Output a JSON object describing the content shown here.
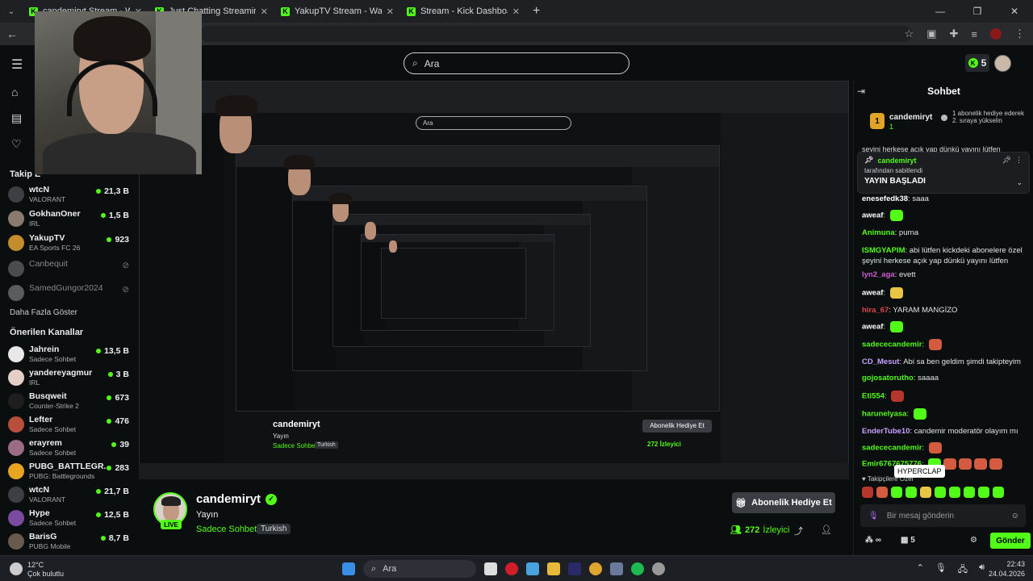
{
  "browser": {
    "tabs": [
      {
        "title": "candemiryt Stream - Watch Live on Kick"
      },
      {
        "title": "Just Chatting Streaming - Live on Kick"
      },
      {
        "title": "YakupTV Stream - Watch Live on Kick"
      },
      {
        "title": "Stream - Kick Dashboard"
      }
    ]
  },
  "topbar": {
    "search_placeholder": "Ara",
    "points": "5"
  },
  "sidebar": {
    "nav": [
      {
        "label": "A"
      },
      {
        "label": "G"
      },
      {
        "label": "T"
      }
    ],
    "following_title": "Takip E",
    "following": [
      {
        "name": "wtcN",
        "sub": "VALORANT",
        "viewers": "21,3 B",
        "online": true
      },
      {
        "name": "GokhanOner",
        "sub": "IRL",
        "viewers": "1,5 B",
        "online": true
      },
      {
        "name": "YakupTV",
        "sub": "EA Sports FC 26",
        "viewers": "923",
        "online": true
      },
      {
        "name": "Canbequit",
        "sub": "",
        "viewers": "",
        "online": false
      },
      {
        "name": "SamedGungor2024",
        "sub": "",
        "viewers": "",
        "online": false
      }
    ],
    "show_more": "Daha Fazla Göster",
    "recommended_title": "Önerilen Kanallar",
    "recommended": [
      {
        "name": "Jahrein",
        "sub": "Sadece Sohbet",
        "viewers": "13,5 B"
      },
      {
        "name": "yandereyagmur",
        "sub": "IRL",
        "viewers": "3 B"
      },
      {
        "name": "Busqweit",
        "sub": "Counter-Strike 2",
        "viewers": "673"
      },
      {
        "name": "Lefter",
        "sub": "Sadece Sohbet",
        "viewers": "476"
      },
      {
        "name": "erayrem",
        "sub": "Sadece Sohbet",
        "viewers": "39"
      },
      {
        "name": "PUBG_BATTLEGR...",
        "sub": "PUBG: Battlegrounds",
        "viewers": "283"
      },
      {
        "name": "wtcN",
        "sub": "VALORANT",
        "viewers": "21,7 B"
      },
      {
        "name": "Hype",
        "sub": "Sadece Sohbet",
        "viewers": "12,5 B"
      },
      {
        "name": "BarisG",
        "sub": "PUBG Mobile",
        "viewers": "8,7 B"
      }
    ]
  },
  "stream_inner": {
    "name": "candemiryt",
    "title": "Yayın",
    "category": "Sadece Sohbet",
    "language": "Turkish",
    "gift": "Abonelik Hediye Et",
    "viewers": "272",
    "viewers_label": "İzleyici"
  },
  "profile": {
    "name": "candemiryt",
    "live": "LIVE",
    "title": "Yayın",
    "category": "Sadece Sohbet",
    "language": "Turkish",
    "gift_button": "Abonelik Hediye Et",
    "viewers": "272",
    "viewers_label": "İzleyici"
  },
  "chat": {
    "title": "Sohbet",
    "gifter": {
      "name": "candemiryt",
      "badge": "1",
      "count": "1",
      "text": "1 abonelik hediye ederek 2. sıraya yükselin"
    },
    "overflow_text": "şeyini herkese açık yap dünkü yayını lütfen",
    "pinned": {
      "by": "candemiryt",
      "label": "tarafından sabitlendi",
      "message": "YAYIN BAŞLADI"
    },
    "messages": [
      {
        "user": "enesefedk38",
        "color": "#ffffff",
        "text": "saaa",
        "emotes": []
      },
      {
        "user": "aweaf",
        "color": "#ffffff",
        "text": "",
        "emotes": [
          "g"
        ]
      },
      {
        "user": "Animuna",
        "color": "#53fc18",
        "text": "purna",
        "emotes": []
      },
      {
        "user": "ISMGYAPIM",
        "color": "#53fc18",
        "text": "abi lütfen kickdeki abonelere özel şeyini herkese açık yap dünkü yayını lütfen",
        "emotes": []
      },
      {
        "user": "lyn2_aga",
        "color": "#d05dd6",
        "text": "evett",
        "emotes": []
      },
      {
        "user": "aweaf",
        "color": "#ffffff",
        "text": "",
        "emotes": [
          "y"
        ]
      },
      {
        "user": "hira_67",
        "color": "#e0474c",
        "text": "YARAM MANGİZO",
        "emotes": []
      },
      {
        "user": "aweaf",
        "color": "#ffffff",
        "text": "",
        "emotes": [
          "g"
        ]
      },
      {
        "user": "sadececandemir",
        "color": "#53fc18",
        "text": "",
        "emotes": [
          "o"
        ]
      },
      {
        "user": "CD_Mesut",
        "color": "#c9a0ff",
        "text": "Abi sa ben geldim şimdi takipteyim",
        "emotes": []
      },
      {
        "user": "gojosatorutho",
        "color": "#53fc18",
        "text": "saaaa",
        "emotes": []
      },
      {
        "user": "Eti554",
        "color": "#53fc18",
        "text": "",
        "emotes": [
          "r"
        ]
      },
      {
        "user": "harunelyasa",
        "color": "#53fc18",
        "text": "",
        "emotes": [
          "g"
        ]
      },
      {
        "user": "EnderTube10",
        "color": "#c9a0ff",
        "text": "candemir moderatör olayım mı",
        "emotes": []
      },
      {
        "user": "sadececandemir",
        "color": "#53fc18",
        "text": "",
        "emotes": [
          "o"
        ]
      },
      {
        "user": "Emir6767675776",
        "color": "#53fc18",
        "text": "",
        "emotes": [
          "g",
          "o",
          "o",
          "o",
          "o"
        ]
      }
    ],
    "tooltip": "HYPERCLAP",
    "follow_hint": "Takipçilere Özel",
    "input_placeholder": "Bir mesaj gönderin",
    "infinite": "∞",
    "gift_count": "5",
    "send": "Gönder"
  },
  "taskbar": {
    "temp": "12°C",
    "weather": "Çok bulutlu",
    "search": "Ara",
    "time": "22:43",
    "date": "24.04.2026"
  }
}
